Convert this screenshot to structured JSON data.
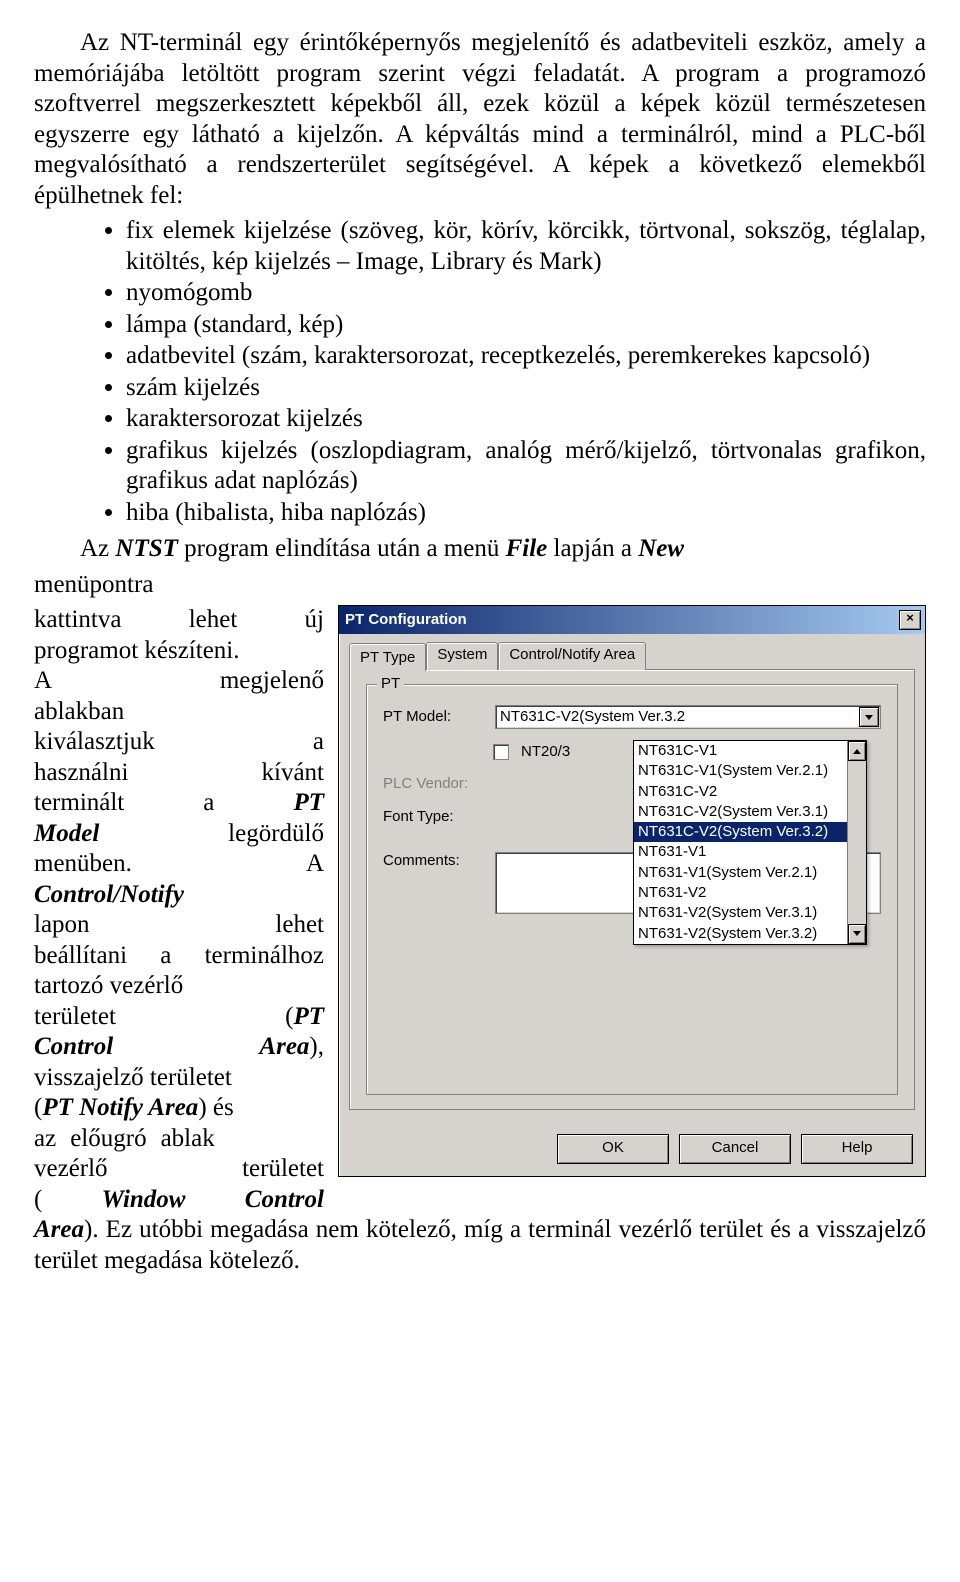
{
  "para1": "Az NT-terminál egy érintőképernyős megjelenítő és adatbeviteli eszköz, amely a memóriájába letöltött program szerint végzi feladatát. A program a programozó szoftverrel megszerkesztett képekből áll, ezek közül a képek közül természetesen egyszerre egy látható a kijelzőn. A képváltás mind a terminálról, mind a PLC-ből megvalósítható a rendszerterület segítségével. A képek a következő elemekből épülhetnek fel:",
  "bullets": [
    "fix elemek kijelzése (szöveg, kör, körív, körcikk, törtvonal, sokszög, téglalap, kitöltés, kép kijelzés – Image, Library és Mark)",
    "nyomógomb",
    "lámpa (standard, kép)",
    "adatbevitel (szám, karaktersorozat, receptkezelés, peremkerekes kapcsoló)",
    "szám kijelzés",
    "karaktersorozat kijelzés",
    "grafikus kijelzés (oszlopdiagram, analóg mérő/kijelző, törtvonalas grafikon, grafikus adat naplózás)",
    "hiba (hibalista, hiba naplózás)"
  ],
  "para2_pre": "Az ",
  "para2_ntst": "NTST",
  "para2_mid": " program elindítása után a menü ",
  "para2_file": "File",
  "para2_mid2": " lapján a ",
  "para2_new": "New",
  "para2_word_menupontra": "menüpontra",
  "wrap": {
    "l1a": "kattintva",
    "l1b": "lehet",
    "l1c": "új",
    "l2": "programot készíteni.",
    "l3a": "A",
    "l3b": "megjelenő",
    "l4": "ablakban",
    "l5a": "kiválasztjuk",
    "l5b": "a",
    "l6a": "használni",
    "l6b": "kívánt",
    "l7a": "terminált",
    "l7b": "a",
    "l7c": "PT",
    "l8a": "Model",
    "l8b": "legördülő",
    "l9a": "menüben.",
    "l9b": "A",
    "l10": "Control/Notify",
    "l11a": "lapon",
    "l11b": "lehet",
    "l12": "beállítani a terminál­hoz tartozó vezérlő",
    "l13a": "területet",
    "l13b": "(",
    "l13c": "PT",
    "l14a": "Control",
    "l14b": "Area",
    "l15": "visszajelző területet",
    "l16a": "(",
    "l16b": "PT Notify Area",
    "l16c": ") és",
    "l17": "az előugró ablak",
    "l18a": "vezérlő",
    "l18b": "területet",
    "l19a": "(",
    "l19b": "Window",
    "l19c": "Control"
  },
  "para3_pre": "Area",
  "para3_rest": "). Ez utóbbi megadása nem kötelező, míg a terminál vezérlő terület és a visszajelző terület megadása kötelező.",
  "dialog": {
    "title": "PT Configuration",
    "tabs": [
      "PT Type",
      "System",
      "Control/Notify Area"
    ],
    "group": "PT",
    "lbl_model": "PT Model:",
    "model_value": "NT631C-V2(System Ver.3.2",
    "chk_label": "NT20/3",
    "lbl_vendor": "PLC Vendor:",
    "lbl_font": "Font Type:",
    "lbl_comments": "Comments:",
    "options": [
      "NT631C-V1",
      "NT631C-V1(System Ver.2.1)",
      "NT631C-V2",
      "NT631C-V2(System Ver.3.1)",
      "NT631C-V2(System Ver.3.2)",
      "NT631-V1",
      "NT631-V1(System Ver.2.1)",
      "NT631-V2",
      "NT631-V2(System Ver.3.1)",
      "NT631-V2(System Ver.3.2)"
    ],
    "selected_index": 4,
    "buttons": {
      "ok": "OK",
      "cancel": "Cancel",
      "help": "Help"
    }
  }
}
